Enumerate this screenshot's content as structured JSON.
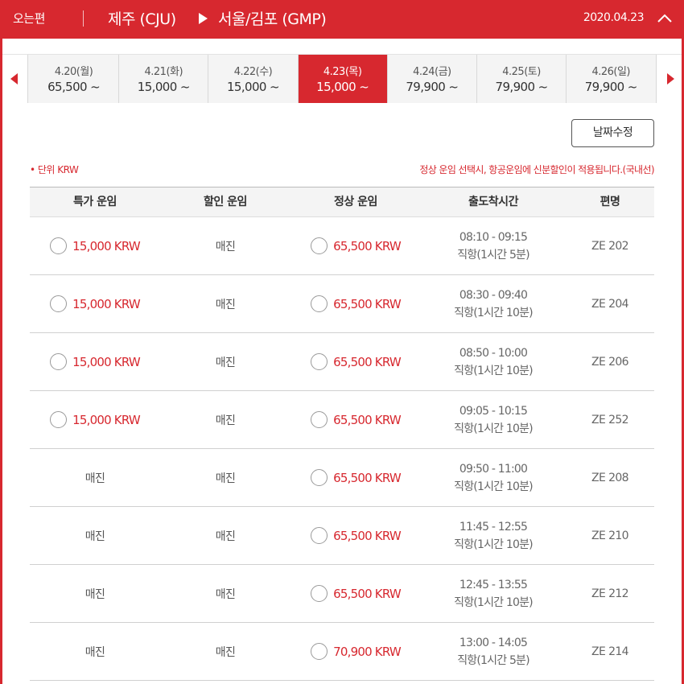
{
  "header": {
    "direction": "오는편",
    "from": "제주 (CJU)",
    "to": "서울/김포 (GMP)",
    "date": "2020.04.23",
    "collapse_icon": "chevron-up-icon"
  },
  "colors": {
    "brand": "#d7282f",
    "text": "#333333"
  },
  "date_nav": {
    "prev_icon": "triangle-left-icon",
    "next_icon": "triangle-right-icon",
    "tabs": [
      {
        "date": "4.20(월)",
        "price": "65,500 ~",
        "active": false
      },
      {
        "date": "4.21(화)",
        "price": "15,000 ~",
        "active": false
      },
      {
        "date": "4.22(수)",
        "price": "15,000 ~",
        "active": false
      },
      {
        "date": "4.23(목)",
        "price": "15,000 ~",
        "active": true
      },
      {
        "date": "4.24(금)",
        "price": "79,900 ~",
        "active": false
      },
      {
        "date": "4.25(토)",
        "price": "79,900 ~",
        "active": false
      },
      {
        "date": "4.26(일)",
        "price": "79,900 ~",
        "active": false
      }
    ]
  },
  "edit_button": "날짜수정",
  "unit_note": "• 단위 KRW",
  "notice": "정상 운임 선택시, 항공운임에 신분할인이 적용됩니다.(국내선)",
  "table": {
    "headers": [
      "특가 운임",
      "할인 운임",
      "정상 운임",
      "출도착시간",
      "편명"
    ],
    "rows": [
      {
        "special": "15,000 KRW",
        "special_available": true,
        "discount": "매진",
        "normal": "65,500 KRW",
        "time": "08:10 - 09:15",
        "duration": "직항(1시간 5분)",
        "flight": "ZE 202"
      },
      {
        "special": "15,000 KRW",
        "special_available": true,
        "discount": "매진",
        "normal": "65,500 KRW",
        "time": "08:30 - 09:40",
        "duration": "직항(1시간 10분)",
        "flight": "ZE 204"
      },
      {
        "special": "15,000 KRW",
        "special_available": true,
        "discount": "매진",
        "normal": "65,500 KRW",
        "time": "08:50 - 10:00",
        "duration": "직항(1시간 10분)",
        "flight": "ZE 206"
      },
      {
        "special": "15,000 KRW",
        "special_available": true,
        "discount": "매진",
        "normal": "65,500 KRW",
        "time": "09:05 - 10:15",
        "duration": "직항(1시간 10분)",
        "flight": "ZE 252"
      },
      {
        "special": "매진",
        "special_available": false,
        "discount": "매진",
        "normal": "65,500 KRW",
        "time": "09:50 - 11:00",
        "duration": "직항(1시간 10분)",
        "flight": "ZE 208"
      },
      {
        "special": "매진",
        "special_available": false,
        "discount": "매진",
        "normal": "65,500 KRW",
        "time": "11:45 - 12:55",
        "duration": "직항(1시간 10분)",
        "flight": "ZE 210"
      },
      {
        "special": "매진",
        "special_available": false,
        "discount": "매진",
        "normal": "65,500 KRW",
        "time": "12:45 - 13:55",
        "duration": "직항(1시간 10분)",
        "flight": "ZE 212"
      },
      {
        "special": "매진",
        "special_available": false,
        "discount": "매진",
        "normal": "70,900 KRW",
        "time": "13:00 - 14:05",
        "duration": "직항(1시간 5분)",
        "flight": "ZE 214"
      }
    ]
  }
}
